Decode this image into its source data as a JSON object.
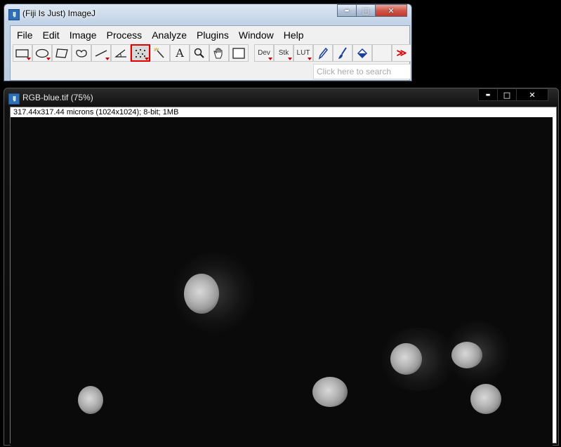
{
  "main_window": {
    "title": "(Fiji Is Just) ImageJ",
    "icon_text": "IJ",
    "menus": [
      "File",
      "Edit",
      "Image",
      "Process",
      "Analyze",
      "Plugins",
      "Window",
      "Help"
    ],
    "tools": [
      {
        "name": "rectangle-tool-icon",
        "has_menu": true
      },
      {
        "name": "oval-tool-icon",
        "has_menu": true
      },
      {
        "name": "polygon-tool-icon",
        "has_menu": false
      },
      {
        "name": "freehand-tool-icon",
        "has_menu": false
      },
      {
        "name": "line-tool-icon",
        "has_menu": true
      },
      {
        "name": "angle-tool-icon",
        "has_menu": false
      },
      {
        "name": "multipoint-tool-icon",
        "has_menu": true,
        "selected": true
      },
      {
        "name": "wand-tool-icon",
        "has_menu": false
      },
      {
        "name": "text-tool-icon",
        "has_menu": false
      },
      {
        "name": "magnifier-tool-icon",
        "has_menu": false
      },
      {
        "name": "hand-tool-icon",
        "has_menu": false
      },
      {
        "name": "color-picker-tool-icon",
        "has_menu": false
      }
    ],
    "dev_label": "Dev",
    "stk_label": "Stk",
    "lut_label": "LUT",
    "text_tool_glyph": "A",
    "overflow_label": "≫",
    "search_placeholder": "Click here to search",
    "selected_tool_color": "#e00000"
  },
  "image_window": {
    "title": "RGB-blue.tif (75%)",
    "icon_text": "IJ",
    "info": "317.44x317.44 microns (1024x1024); 8-bit; 1MB"
  },
  "window_controls": {
    "minimize": "▬",
    "maximize": "□",
    "close": "✕"
  }
}
